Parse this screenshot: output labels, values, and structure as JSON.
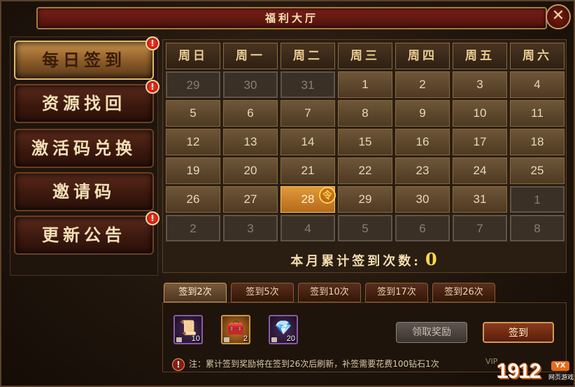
{
  "window": {
    "title": "福利大厅",
    "close_glyph": "✕"
  },
  "sidebar": {
    "items": [
      {
        "label": "每日签到",
        "active": true,
        "alert": true
      },
      {
        "label": "资源找回",
        "active": false,
        "alert": true
      },
      {
        "label": "激活码兑换",
        "active": false,
        "alert": false
      },
      {
        "label": "邀请码",
        "active": false,
        "alert": false
      },
      {
        "label": "更新公告",
        "active": false,
        "alert": true
      }
    ],
    "alert_glyph": "!"
  },
  "calendar": {
    "weekdays": [
      "周日",
      "周一",
      "周二",
      "周三",
      "周四",
      "周五",
      "周六"
    ],
    "weeks": [
      [
        "29",
        "30",
        "31",
        "1",
        "2",
        "3",
        "4"
      ],
      [
        "5",
        "6",
        "7",
        "8",
        "9",
        "10",
        "11"
      ],
      [
        "12",
        "13",
        "14",
        "15",
        "16",
        "17",
        "18"
      ],
      [
        "19",
        "20",
        "21",
        "22",
        "23",
        "24",
        "25"
      ],
      [
        "26",
        "27",
        "28",
        "29",
        "30",
        "31",
        "1"
      ],
      [
        "2",
        "3",
        "4",
        "5",
        "6",
        "7",
        "8"
      ]
    ],
    "today_badge": "令",
    "summary_label": "本月累计签到次数:",
    "summary_count": "0"
  },
  "rewards": {
    "tabs": [
      "签到2次",
      "签到5次",
      "签到10次",
      "签到17次",
      "签到26次"
    ],
    "items": [
      {
        "icon": "scroll-icon",
        "glyph": "📜",
        "qty": "10",
        "style": "purple"
      },
      {
        "icon": "treasure-chest-icon",
        "glyph": "🧰",
        "qty": "2",
        "style": "gold"
      },
      {
        "icon": "crystal-icon",
        "glyph": "💎",
        "qty": "20",
        "style": "purple"
      }
    ],
    "claim_label": "领取奖励",
    "sign_label": "签到",
    "note": "注：累计签到奖励将在签到26次后刷新，补签需要花费100钻石1次",
    "vip_text": "VIP"
  },
  "watermark": {
    "number": "1912",
    "badge": "YX",
    "sub": "网页游戏"
  }
}
